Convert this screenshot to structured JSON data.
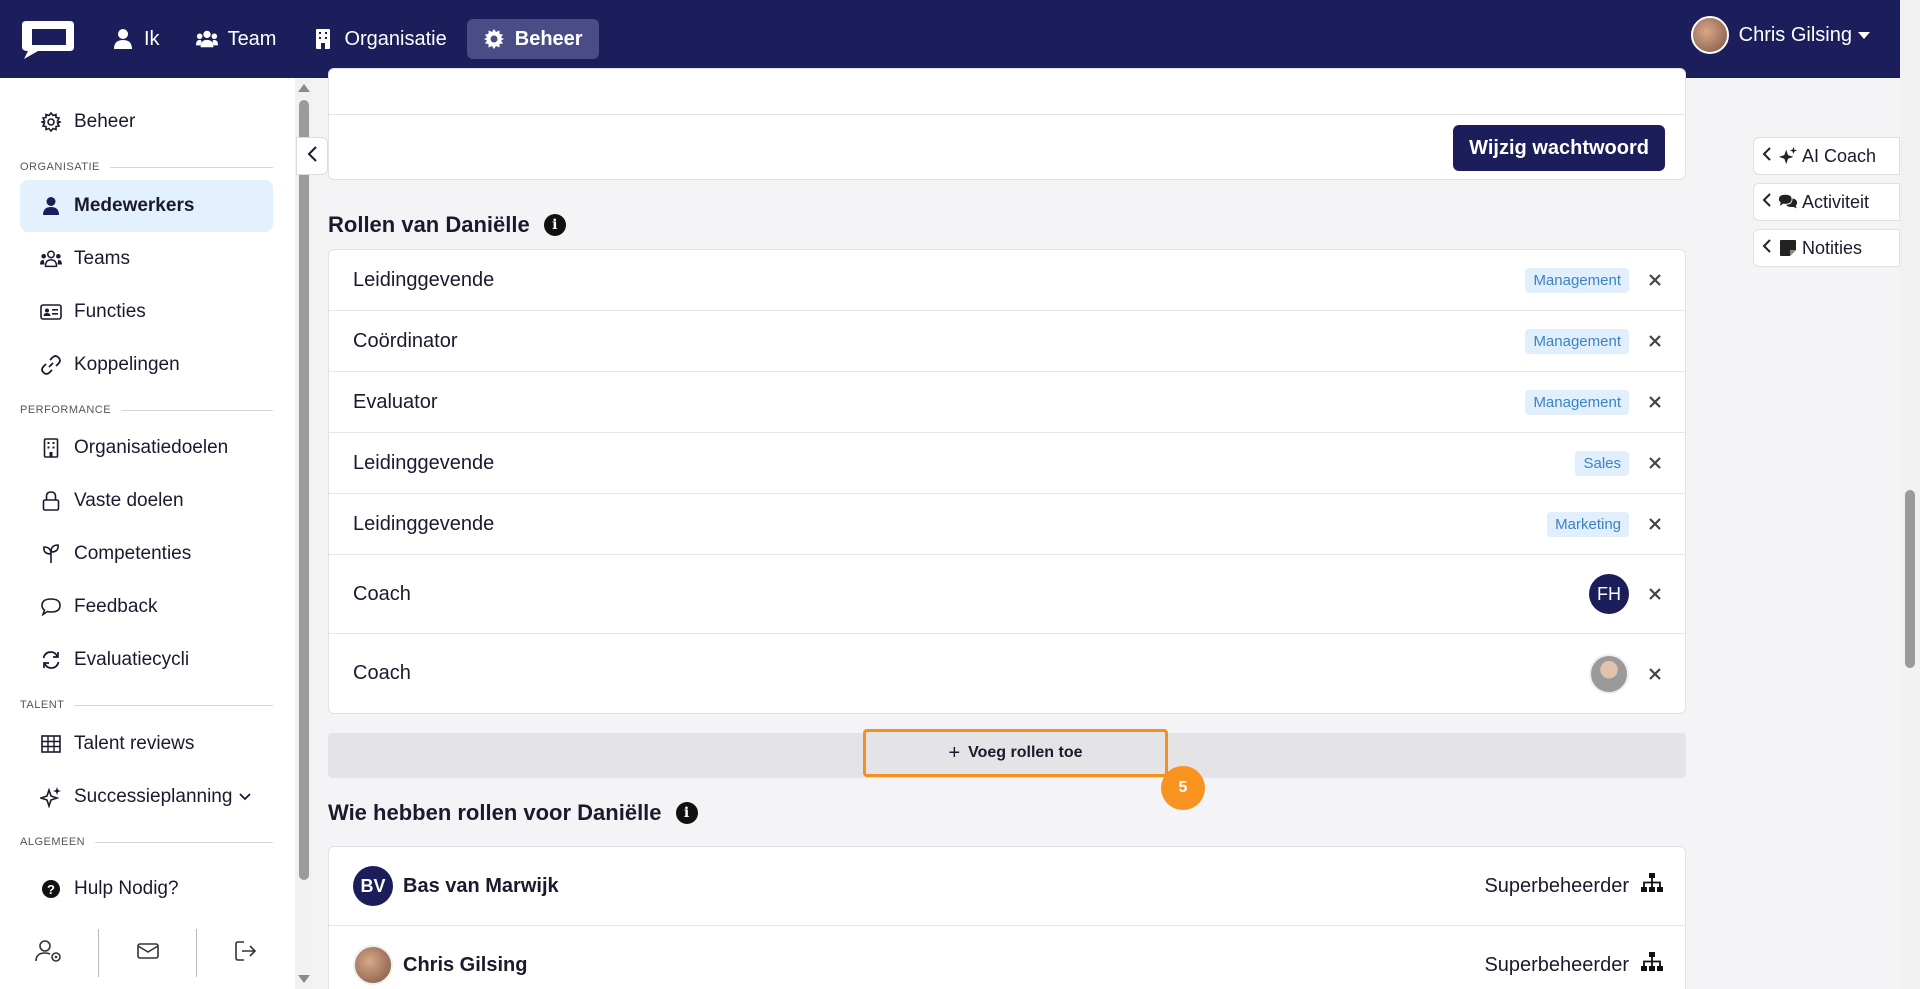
{
  "topnav": {
    "items": [
      {
        "label": "Ik",
        "icon": "user-icon"
      },
      {
        "label": "Team",
        "icon": "users-icon"
      },
      {
        "label": "Organisatie",
        "icon": "building-icon"
      },
      {
        "label": "Beheer",
        "icon": "gear-icon",
        "active": true
      }
    ],
    "user_name": "Chris Gilsing"
  },
  "sidebar": {
    "top_item": "Beheer",
    "sections": {
      "organisatie": "ORGANISATIE",
      "performance": "PERFORMANCE",
      "talent": "TALENT",
      "algemeen": "ALGEMEEN"
    },
    "items": {
      "medewerkers": "Medewerkers",
      "teams": "Teams",
      "functies": "Functies",
      "koppelingen": "Koppelingen",
      "organisatiedoelen": "Organisatiedoelen",
      "vaste_doelen": "Vaste doelen",
      "competenties": "Competenties",
      "feedback": "Feedback",
      "evaluatiecycli": "Evaluatiecycli",
      "talent_reviews": "Talent reviews",
      "successieplanning": "Successieplanning",
      "hulp": "Hulp Nodig?"
    }
  },
  "main": {
    "change_password_label": "Wijzig wachtwoord",
    "roles_title": "Rollen van Daniëlle",
    "roles": [
      {
        "name": "Leidinggevende",
        "badge": "Management"
      },
      {
        "name": "Coördinator",
        "badge": "Management"
      },
      {
        "name": "Evaluator",
        "badge": "Management"
      },
      {
        "name": "Leidinggevende",
        "badge": "Sales"
      },
      {
        "name": "Leidinggevende",
        "badge": "Marketing"
      },
      {
        "name": "Coach",
        "initials": "FH"
      },
      {
        "name": "Coach",
        "photo": true
      }
    ],
    "add_roles_label": "Voeg rollen toe",
    "step_number": "5",
    "holders_title": "Wie hebben rollen voor Daniëlle",
    "holders": [
      {
        "initials": "BV",
        "name": "Bas van Marwijk",
        "role": "Superbeheerder"
      },
      {
        "name": "Chris Gilsing",
        "role": "Superbeheerder"
      }
    ]
  },
  "right_panel": {
    "tabs": [
      "AI Coach",
      "Activiteit",
      "Notities"
    ]
  },
  "colors": {
    "nav_bg": "#1c1d5b",
    "accent_orange": "#f5901e",
    "badge_bg": "#e1eefb",
    "badge_text": "#3b84c4",
    "active_side_bg": "#e2f1fd"
  }
}
